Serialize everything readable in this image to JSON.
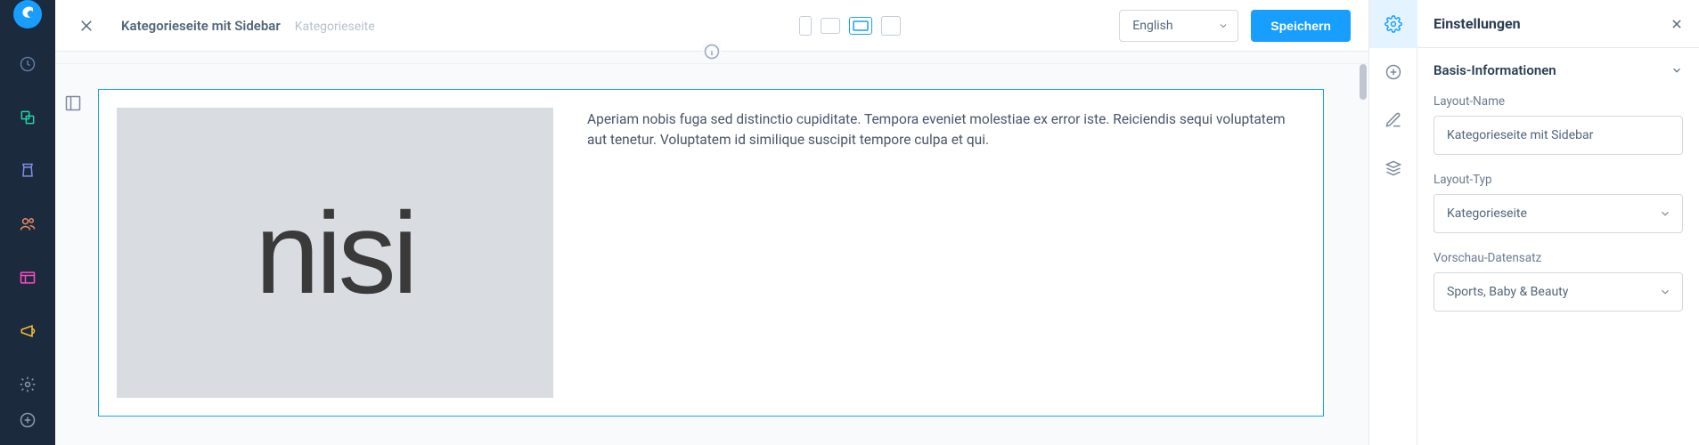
{
  "header": {
    "title_main": "Kategorieseite mit Sidebar",
    "title_sub": "Kategorieseite",
    "language": "English",
    "save_label": "Speichern"
  },
  "canvas": {
    "image_text": "nisi",
    "paragraph": "Aperiam nobis fuga sed distinctio cupiditate. Tempora eveniet molestiae ex error iste. Reiciendis sequi voluptatem aut tenetur. Voluptatem id similique suscipit tempore culpa et qui."
  },
  "settings": {
    "panel_title": "Einstellungen",
    "section_title": "Basis-Informationen",
    "layout_name_label": "Layout-Name",
    "layout_name_value": "Kategorieseite mit Sidebar",
    "layout_type_label": "Layout-Typ",
    "layout_type_value": "Kategorieseite",
    "preview_label": "Vorschau-Datensatz",
    "preview_value": "Sports, Baby & Beauty"
  },
  "colors": {
    "accent": "#189eff",
    "nav_bg": "#1c2a3d"
  }
}
